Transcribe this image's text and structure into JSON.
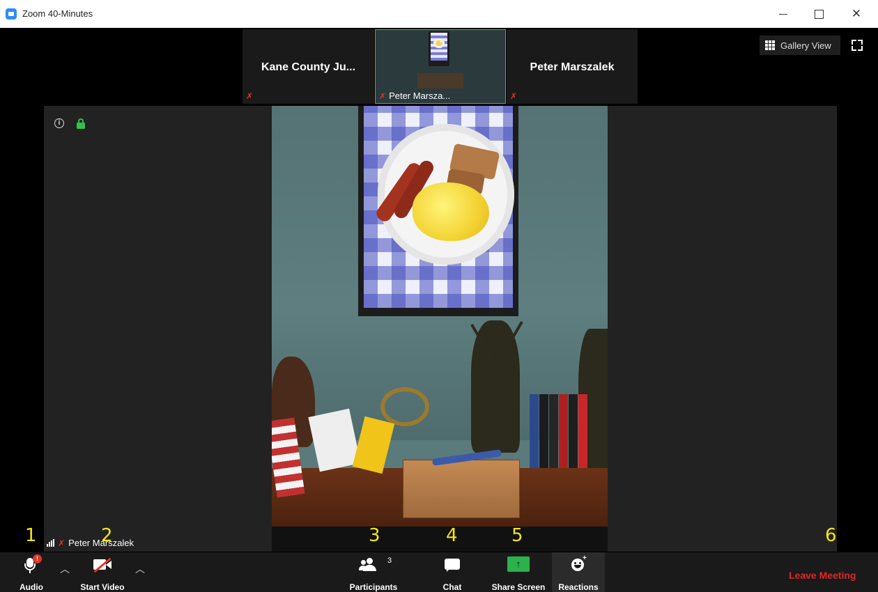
{
  "window": {
    "title": "Zoom 40-Minutes",
    "minimize": "–",
    "maximize": "□",
    "close": "✕"
  },
  "strip": {
    "tile1_name": "Kane County Ju...",
    "tile2_name": "Peter Marsza...",
    "tile3_name": "Peter Marszalek"
  },
  "view": {
    "gallery_label": "Gallery View"
  },
  "self_video": {
    "name": "Peter Marszalek"
  },
  "toolbar": {
    "audio_label": "Audio",
    "audio_badge": "!",
    "video_label": "Start Video",
    "participants_label": "Participants",
    "participants_count": "3",
    "chat_label": "Chat",
    "share_label": "Share Screen",
    "share_arrow": "↑",
    "reactions_label": "Reactions",
    "leave_label": "Leave Meeting"
  },
  "annotations": [
    "1",
    "2",
    "3",
    "4",
    "5",
    "6"
  ],
  "colors": {
    "accent": "#2d8cff",
    "muted_red": "#e0352b",
    "share_green": "#2bb24c",
    "leave_red": "#e02828",
    "annotation_yellow": "#f5e31b"
  },
  "icons": [
    "zoom-app-icon",
    "mic-off-icon",
    "grid-icon",
    "fullscreen-icon",
    "info-icon",
    "lock-icon",
    "signal-icon",
    "mic-icon",
    "video-off-icon",
    "participants-icon",
    "chat-icon",
    "share-screen-icon",
    "reactions-icon"
  ]
}
